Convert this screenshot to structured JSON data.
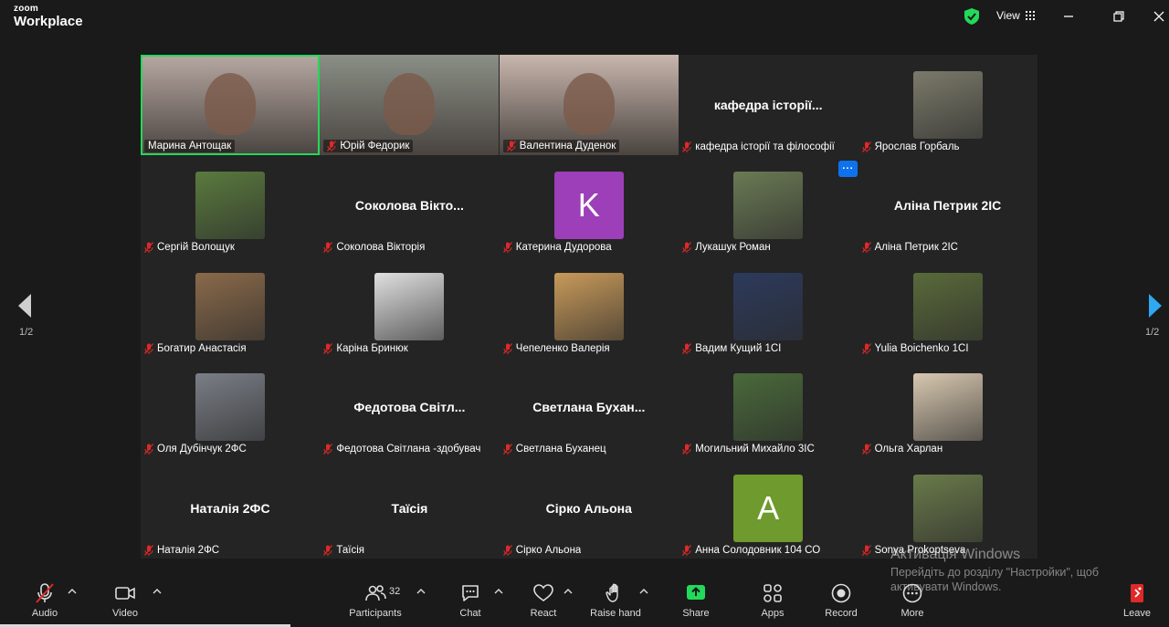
{
  "app": {
    "brand_small": "zoom",
    "brand_big": "Workplace"
  },
  "header": {
    "view_label": "View"
  },
  "tiles": [
    {
      "label": "Марина Антощак",
      "type": "video",
      "active": true,
      "color": "#b7a8a2"
    },
    {
      "label": "Юрій Федорик",
      "type": "video",
      "color": "#8a8f86"
    },
    {
      "label": "Валентина Дуденок",
      "type": "video",
      "color": "#c8b6ae"
    },
    {
      "label": "кафедра історії та філософії",
      "type": "name",
      "display": "кафедра історії..."
    },
    {
      "label": "Ярослав Горбаль",
      "type": "photo",
      "color": "#7b7a6a"
    },
    {
      "label": "Сергій Волощук",
      "type": "photo",
      "color": "#5a7a3e"
    },
    {
      "label": "Соколова Вікторія",
      "type": "name",
      "display": "Соколова  Вікто..."
    },
    {
      "label": "Катерина Дудорова",
      "type": "letter",
      "letter": "K",
      "color": "#9c3fb8"
    },
    {
      "label": "Лукашук Роман",
      "type": "photo",
      "color": "#6b7a55"
    },
    {
      "label": "Аліна Петрик 2ІС",
      "type": "name",
      "display": "Аліна Петрик 2ІС"
    },
    {
      "label": "Богатир Анастасія",
      "type": "photo",
      "color": "#8a6a4a"
    },
    {
      "label": "Каріна Бринюк",
      "type": "photo",
      "color": "#e0e0e0"
    },
    {
      "label": "Чепеленко Валерія",
      "type": "photo",
      "color": "#c89a5a"
    },
    {
      "label": "Вадим Кущий 1СІ",
      "type": "photo",
      "color": "#2c3a5c"
    },
    {
      "label": "Yulia Boichenko 1CI",
      "type": "photo",
      "color": "#5a6a3a"
    },
    {
      "label": "Оля Дубінчук 2ФС",
      "type": "photo",
      "color": "#7a7e86"
    },
    {
      "label": "Федотова Світлана -здобувач",
      "type": "name",
      "display": "Федотова  Світл..."
    },
    {
      "label": "Светлана Буханец",
      "type": "name",
      "display": "Светлана  Бухан..."
    },
    {
      "label": "Могильний Михайло 3ІС",
      "type": "photo",
      "color": "#4a6a3a"
    },
    {
      "label": "Ольга Харлан",
      "type": "photo",
      "color": "#d8c8b0"
    },
    {
      "label": "Наталія 2ФС",
      "type": "name",
      "display": "Наталія 2ФС"
    },
    {
      "label": "Таїсія",
      "type": "name",
      "display": "Таїсія"
    },
    {
      "label": "Сірко Альона",
      "type": "name",
      "display": "Сірко Альона"
    },
    {
      "label": "Анна Солодовник 104 СО",
      "type": "letter",
      "letter": "A",
      "color": "#6e9a2e"
    },
    {
      "label": "Sonya Prokoptseva",
      "type": "photo",
      "color": "#6a7a4a"
    }
  ],
  "pagination": {
    "left": "1/2",
    "right": "1/2"
  },
  "more_label": "···",
  "toolbar": {
    "audio": "Audio",
    "video": "Video",
    "participants": "Participants",
    "participant_count": "32",
    "chat": "Chat",
    "react": "React",
    "raise_hand": "Raise hand",
    "share": "Share",
    "apps": "Apps",
    "record": "Record",
    "more": "More",
    "leave": "Leave"
  },
  "watermark": {
    "line1": "Активація Windows",
    "line2": "Перейдіть до розділу \"Настройки\", щоб",
    "line3": "активувати Windows."
  },
  "colors": {
    "active_border": "#23d959",
    "accent": "#0e72ed",
    "muted_red": "#e02828",
    "share_green": "#23d959",
    "leave_red": "#e02828"
  }
}
